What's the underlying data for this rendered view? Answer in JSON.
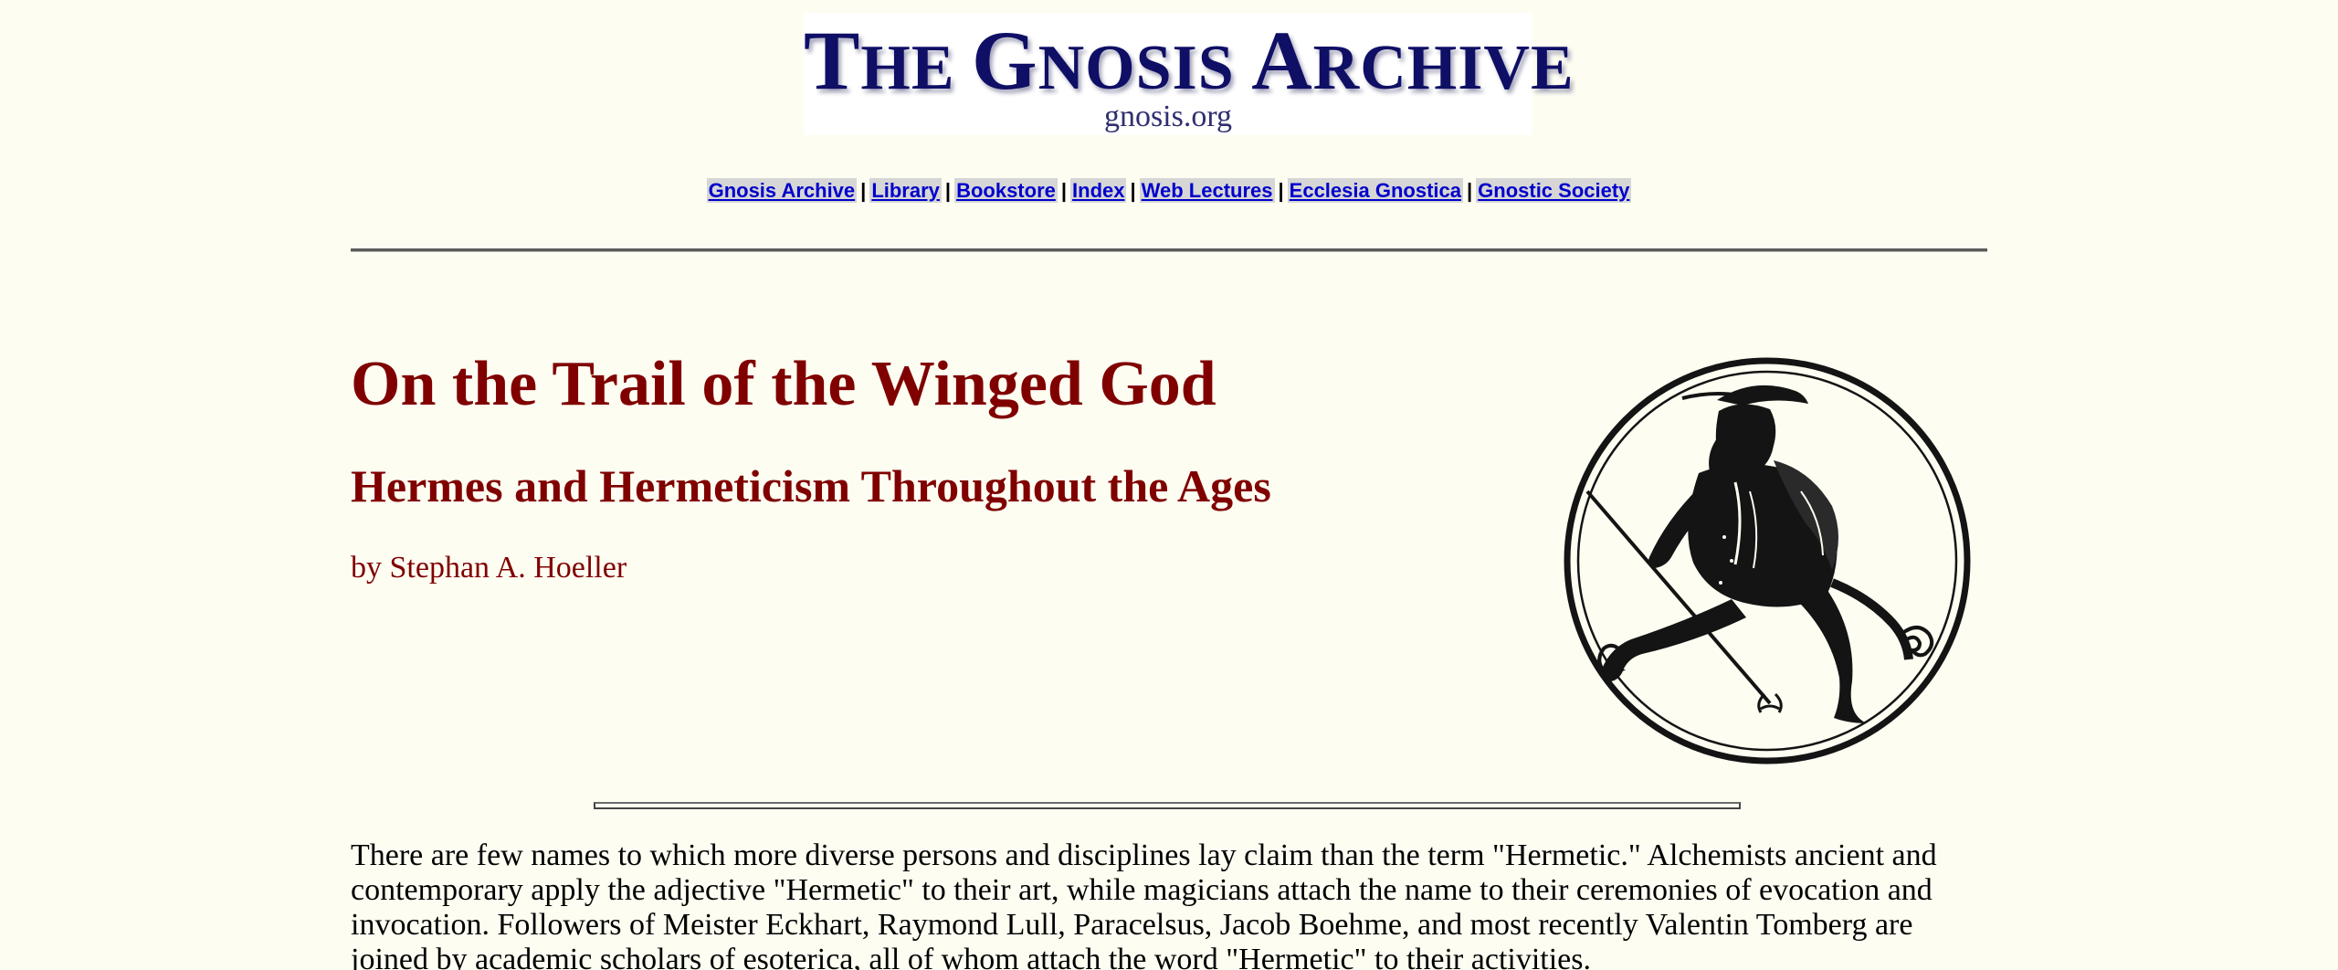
{
  "logo": {
    "title_parts": [
      {
        "text": "T",
        "big": true
      },
      {
        "text": "HE ",
        "big": false
      },
      {
        "text": "G",
        "big": true
      },
      {
        "text": "NOSIS ",
        "big": false
      },
      {
        "text": "A",
        "big": true
      },
      {
        "text": "RCHIVE",
        "big": false
      }
    ],
    "subtitle": "gnosis.org"
  },
  "nav": {
    "links": [
      {
        "label": "Gnosis Archive"
      },
      {
        "label": "Library"
      },
      {
        "label": "Bookstore"
      },
      {
        "label": "Index"
      },
      {
        "label": "Web Lectures"
      },
      {
        "label": "Ecclesia Gnostica"
      },
      {
        "label": "Gnostic Society"
      }
    ],
    "separator": "|"
  },
  "article": {
    "title": "On the Trail of the Winged God",
    "subtitle": "Hermes and Hermeticism Throughout the Ages",
    "author": "by Stephan A. Hoeller",
    "intro": "There are few names to which more diverse persons and disciplines lay claim than the term \"Hermetic.\" Alchemists ancient and contemporary apply the adjective \"Hermetic\" to their art, while magicians attach the name to their ceremonies of evocation and invocation. Followers of Meister Eckhart, Raymond Lull, Paracelsus, Jacob Boehme, and most recently Valentin Tomberg are joined by academic scholars of esoterica, all of whom attach the word \"Hermetic\" to their activities."
  },
  "illustration": {
    "icon": "hermes-medallion-icon",
    "ink_color": "#141414",
    "paper_color": "#fdfdf2"
  },
  "colors": {
    "heading": "#800000",
    "link": "#0000cc",
    "background": "#fdfdf2"
  }
}
